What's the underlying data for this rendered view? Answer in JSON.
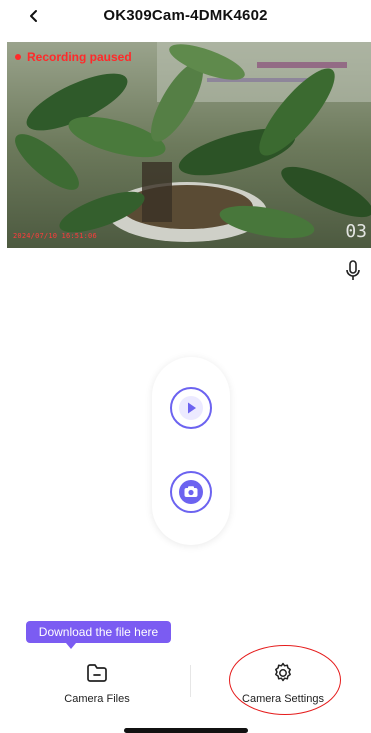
{
  "header": {
    "title": "OK309Cam-4DMK4602",
    "back_icon": "chevron-left-icon"
  },
  "video": {
    "status_text": "Recording paused",
    "timestamp": "2024/07/10 16:51:06",
    "corner_label": "03",
    "status_color": "#ff2a2a"
  },
  "controls": {
    "mic_icon": "microphone-icon",
    "play_icon": "play-icon",
    "snapshot_icon": "camera-icon",
    "accent_color": "#6c63f0"
  },
  "tooltip": {
    "text": "Download the file here",
    "color": "#7b5cf2"
  },
  "bottom_nav": {
    "files_label": "Camera Files",
    "files_icon": "folder-icon",
    "settings_label": "Camera Settings",
    "settings_icon": "gear-icon",
    "highlight_color": "#e51c1c"
  }
}
